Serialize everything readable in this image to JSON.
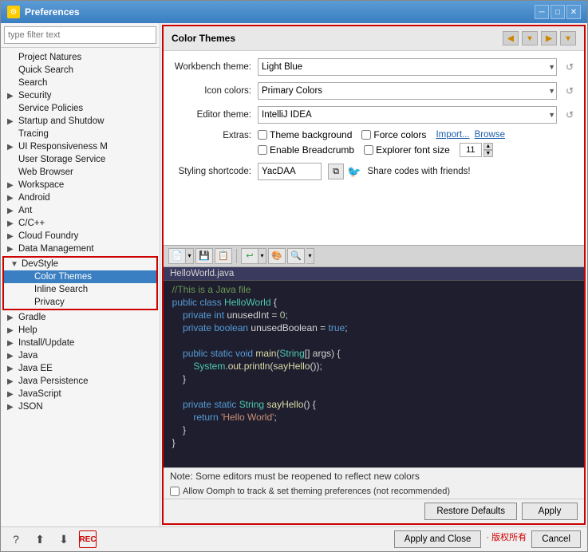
{
  "window": {
    "title": "Preferences",
    "icon": "⚙"
  },
  "sidebar": {
    "filter_placeholder": "type filter text",
    "items": [
      {
        "id": "project-natures",
        "label": "Project Natures",
        "level": 1,
        "arrow": "",
        "selected": false
      },
      {
        "id": "quick-search",
        "label": "Quick Search",
        "level": 1,
        "arrow": "",
        "selected": false
      },
      {
        "id": "search",
        "label": "Search",
        "level": 1,
        "arrow": "",
        "selected": false
      },
      {
        "id": "security",
        "label": "Security",
        "level": 1,
        "arrow": "▶",
        "selected": false
      },
      {
        "id": "service-policies",
        "label": "Service Policies",
        "level": 1,
        "arrow": "",
        "selected": false
      },
      {
        "id": "startup-shutdown",
        "label": "Startup and Shutdow",
        "level": 1,
        "arrow": "▶",
        "selected": false
      },
      {
        "id": "tracing",
        "label": "Tracing",
        "level": 1,
        "arrow": "",
        "selected": false
      },
      {
        "id": "ui-responsiveness",
        "label": "UI Responsiveness M",
        "level": 1,
        "arrow": "▶",
        "selected": false
      },
      {
        "id": "user-storage",
        "label": "User Storage Service",
        "level": 1,
        "arrow": "",
        "selected": false
      },
      {
        "id": "web-browser",
        "label": "Web Browser",
        "level": 1,
        "arrow": "",
        "selected": false
      },
      {
        "id": "workspace",
        "label": "Workspace",
        "level": 1,
        "arrow": "▶",
        "selected": false
      },
      {
        "id": "android",
        "label": "Android",
        "level": 0,
        "arrow": "▶",
        "selected": false
      },
      {
        "id": "ant",
        "label": "Ant",
        "level": 0,
        "arrow": "▶",
        "selected": false
      },
      {
        "id": "cpp",
        "label": "C/C++",
        "level": 0,
        "arrow": "▶",
        "selected": false
      },
      {
        "id": "cloud-foundry",
        "label": "Cloud Foundry",
        "level": 0,
        "arrow": "▶",
        "selected": false
      },
      {
        "id": "data-management",
        "label": "Data Management",
        "level": 0,
        "arrow": "▶",
        "selected": false
      },
      {
        "id": "devstyle",
        "label": "DevStyle",
        "level": 0,
        "arrow": "▼",
        "selected": false,
        "expanded": true
      },
      {
        "id": "color-themes",
        "label": "Color Themes",
        "level": 1,
        "arrow": "",
        "selected": true
      },
      {
        "id": "inline-search",
        "label": "Inline Search",
        "level": 1,
        "arrow": "",
        "selected": false
      },
      {
        "id": "privacy",
        "label": "Privacy",
        "level": 1,
        "arrow": "",
        "selected": false
      },
      {
        "id": "gradle",
        "label": "Gradle",
        "level": 0,
        "arrow": "▶",
        "selected": false
      },
      {
        "id": "help",
        "label": "Help",
        "level": 0,
        "arrow": "▶",
        "selected": false
      },
      {
        "id": "install-update",
        "label": "Install/Update",
        "level": 0,
        "arrow": "▶",
        "selected": false
      },
      {
        "id": "java",
        "label": "Java",
        "level": 0,
        "arrow": "▶",
        "selected": false
      },
      {
        "id": "java-ee",
        "label": "Java EE",
        "level": 0,
        "arrow": "▶",
        "selected": false
      },
      {
        "id": "java-persistence",
        "label": "Java Persistence",
        "level": 0,
        "arrow": "▶",
        "selected": false
      },
      {
        "id": "javascript",
        "label": "JavaScript",
        "level": 0,
        "arrow": "▶",
        "selected": false
      },
      {
        "id": "json",
        "label": "JSON",
        "level": 0,
        "arrow": "▶",
        "selected": false
      }
    ]
  },
  "panel": {
    "title": "Color Themes",
    "workbench_label": "Workbench theme:",
    "workbench_value": "Light Blue",
    "icon_label": "Icon colors:",
    "icon_value": "Primary Colors",
    "editor_label": "Editor theme:",
    "editor_value": "IntelliJ IDEA",
    "extras_label": "Extras:",
    "theme_bg_label": "Theme background",
    "force_colors_label": "Force colors",
    "import_label": "Import...",
    "browse_label": "Browse",
    "enable_breadcrumb_label": "Enable Breadcrumb",
    "explorer_font_label": "Explorer font size",
    "font_size_value": "11",
    "shortcode_label": "Styling shortcode:",
    "shortcode_value": "YacDAA",
    "share_text": "Share codes with friends!",
    "filename": "HelloWorld.java",
    "code_lines": [
      {
        "num": "",
        "text": "  //This is a Java file",
        "classes": "c-comment"
      },
      {
        "num": "",
        "text": "  public class HelloWorld {",
        "classes": "c-plain"
      },
      {
        "num": "",
        "text": "      private int unusedInt = 0;",
        "classes": "c-plain"
      },
      {
        "num": "",
        "text": "      private boolean unusedBoolean = true;",
        "classes": "c-plain"
      },
      {
        "num": "",
        "text": "",
        "classes": ""
      },
      {
        "num": "",
        "text": "      public static void main(String[] args) {",
        "classes": "c-plain"
      },
      {
        "num": "",
        "text": "          System.out.println(sayHello());",
        "classes": "c-plain"
      },
      {
        "num": "",
        "text": "      }",
        "classes": "c-plain"
      },
      {
        "num": "",
        "text": "",
        "classes": ""
      },
      {
        "num": "",
        "text": "      private static String sayHello() {",
        "classes": "c-plain"
      },
      {
        "num": "",
        "text": "          return 'Hello World';",
        "classes": "c-plain"
      },
      {
        "num": "",
        "text": "      }",
        "classes": "c-plain"
      },
      {
        "num": "",
        "text": "  }",
        "classes": "c-plain"
      }
    ],
    "note_text": "Note: Some editors must be reopened to reflect new colors",
    "oomph_text": "Allow Oomph to track & set theming preferences (not recommended)",
    "restore_defaults": "Restore Defaults",
    "apply_label": "Apply"
  },
  "footer": {
    "apply_close_label": "Apply and Close",
    "cancel_label": "Cancel",
    "watermark": "· 版权所有"
  },
  "toolbar_icons": {
    "back": "◀",
    "forward": "▶",
    "nav_left": "◀",
    "nav_right": "▶"
  }
}
